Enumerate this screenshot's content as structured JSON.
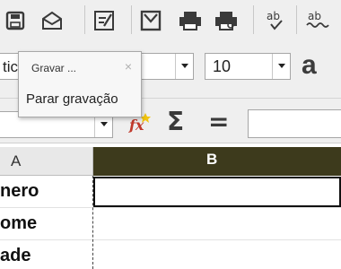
{
  "formatting": {
    "font_name_value": "tic",
    "font_size_value": "10",
    "char_style_glyph": "a"
  },
  "formula_bar": {
    "sigma_glyph": "Σ",
    "equals_glyph": "="
  },
  "columns": [
    {
      "label": "A"
    },
    {
      "label": "B"
    }
  ],
  "rows": [
    {
      "a": "nero"
    },
    {
      "a": "ome"
    },
    {
      "a": "ade"
    }
  ],
  "macro_popup": {
    "title": "Gravar ...",
    "close_glyph": "×",
    "stop_label": "Parar gravação"
  },
  "colors": {
    "selected_column_header": "#3d3a1c",
    "toolbar_bg": "#efefef"
  }
}
